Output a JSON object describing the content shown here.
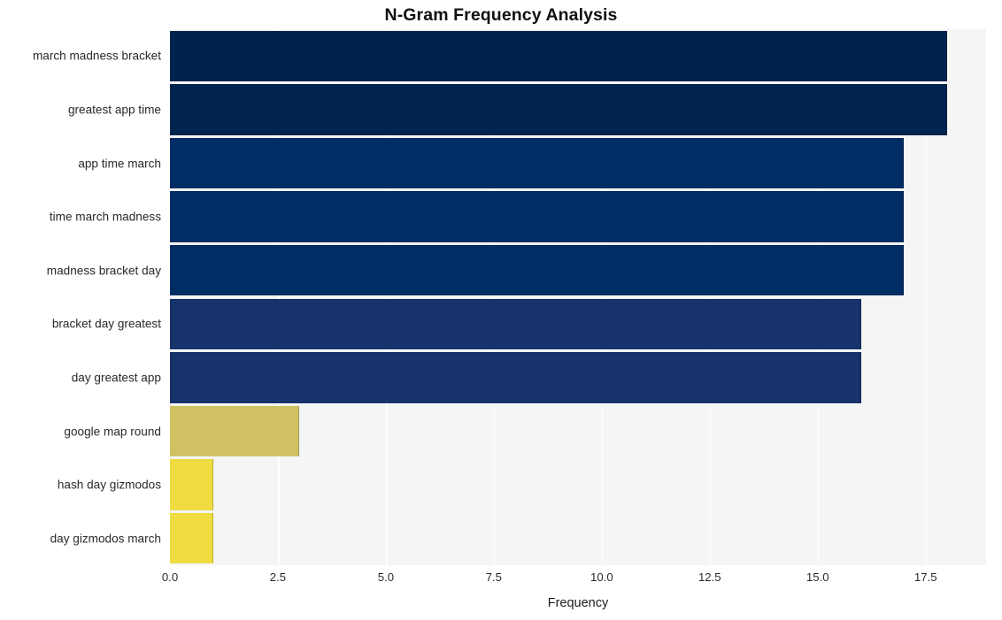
{
  "chart_data": {
    "type": "bar",
    "orientation": "horizontal",
    "title": "N-Gram Frequency Analysis",
    "xlabel": "Frequency",
    "ylabel": "",
    "categories": [
      "march madness bracket",
      "greatest app time",
      "app time march",
      "time march madness",
      "madness bracket day",
      "bracket day greatest",
      "day greatest app",
      "google map round",
      "hash day gizmodos",
      "day gizmodos march"
    ],
    "values": [
      18,
      18,
      17,
      17,
      17,
      16,
      16,
      3,
      1,
      1
    ],
    "bar_colors": [
      "#00224e",
      "#00234f",
      "#002d63",
      "#002d63",
      "#002d63",
      "#16336b",
      "#16336b",
      "#d0c263",
      "#efdc41",
      "#efdc41"
    ],
    "xlim": [
      0,
      18.9
    ],
    "ylim": [
      0,
      10
    ],
    "xticks": [
      0.0,
      2.5,
      5.0,
      7.5,
      10.0,
      12.5,
      15.0,
      17.5
    ],
    "xticklabels": [
      "0.0",
      "2.5",
      "5.0",
      "7.5",
      "10.0",
      "12.5",
      "15.0",
      "17.5"
    ],
    "grid": {
      "vertical": true,
      "horizontal": false,
      "color": "#ffffff"
    },
    "legend": null,
    "plot_background": "#f5f5f5",
    "figure_background": "#ffffff",
    "colormap": "cividis"
  }
}
